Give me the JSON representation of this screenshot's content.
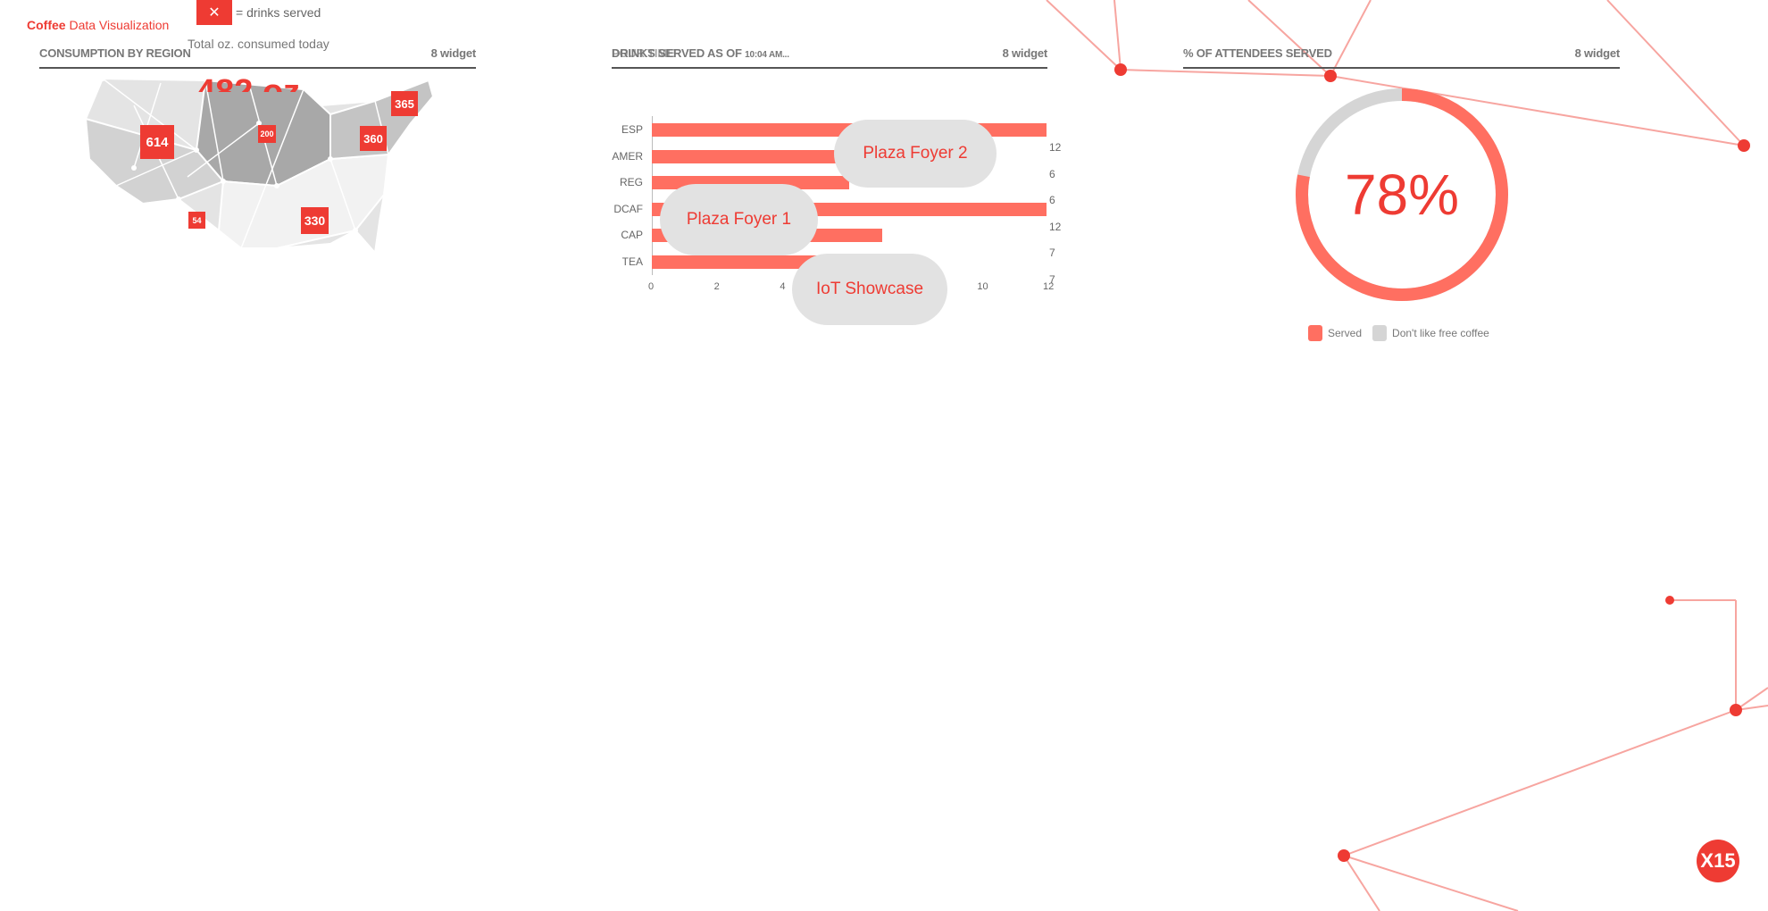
{
  "header": {
    "brand_bold": "Coffee",
    "brand_rest": " Data Visualization",
    "legend_key_text": "= drinks served",
    "subtitle": "Total oz. consumed today",
    "total_value": "482 oz."
  },
  "panels": {
    "region": {
      "title": "CONSUMPTION BY REGION",
      "widget": "8 widget"
    },
    "drinks": {
      "title": "DRINKS SERVED AS OF",
      "time": "10:04 AM...",
      "ghost_title": "POUR TIME",
      "widget": "8 widget"
    },
    "attendees": {
      "title": "% OF ATTENDEES SERVED",
      "widget": "8 widget"
    }
  },
  "map": {
    "badges": [
      "614",
      "200",
      "365",
      "360",
      "54",
      "330"
    ]
  },
  "chart_data": {
    "type": "bar",
    "orientation": "horizontal",
    "categories": [
      "ESP",
      "AMER",
      "REG",
      "DCAF",
      "CAP",
      "TEA"
    ],
    "values": [
      12,
      6,
      6,
      12,
      7,
      7
    ],
    "right_labels": [
      "12",
      "6",
      "6",
      "12",
      "7",
      "7"
    ],
    "xlim": [
      0,
      12
    ],
    "xticks": [
      "0",
      "2",
      "4",
      "6",
      "8",
      "10",
      "12"
    ],
    "bar_color": "#ff6f61"
  },
  "locations": [
    "Plaza Foyer 2",
    "Plaza Foyer 1",
    "IoT Showcase"
  ],
  "donut": {
    "percent": 78,
    "label": "78%",
    "served_color": "#ff6f61",
    "other_color": "#d5d5d5",
    "legend": [
      "Served",
      "Don't like free coffee"
    ]
  },
  "logo": {
    "text": "X15"
  },
  "colors": {
    "accent": "#ee3b33",
    "bar": "#ff6f61",
    "line": "#f7a5a0"
  }
}
